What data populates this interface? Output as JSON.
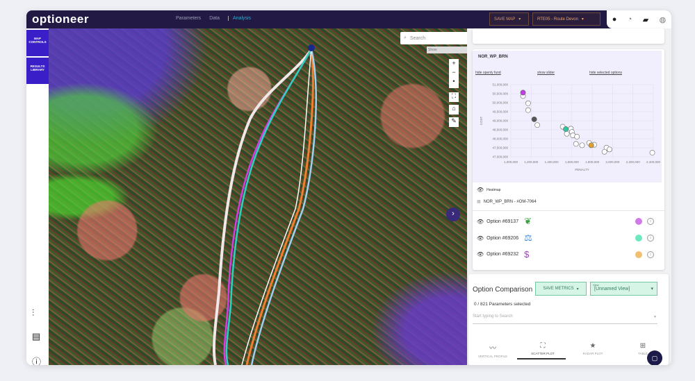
{
  "header": {
    "logo": "optioneer",
    "nav": [
      "Parameters",
      "Data",
      "Analysis"
    ],
    "active_nav": "Analysis",
    "save_map_label": "SAVE MAP",
    "project_label": "Project",
    "project_value": "RTE05 - Route Devon",
    "icons": [
      "help-icon",
      "speedometer-icon",
      "feedback-icon",
      "account-icon"
    ]
  },
  "sidebar": {
    "buttons": [
      "MAP CONTROLS",
      "RESULTS LIBRARY"
    ],
    "icons": [
      "layers-icon",
      "chat-icon",
      "info-icon"
    ]
  },
  "map": {
    "search_placeholder": "Search",
    "search_hint": "Show",
    "controls": [
      "+",
      "−",
      "•"
    ]
  },
  "chart_card": {
    "title": "NOR_WP_BRN",
    "links": [
      "hide openly fund",
      "show slider",
      "hide selected options"
    ]
  },
  "chart_data": {
    "type": "scatter",
    "xlabel": "PENALTY",
    "ylabel": "COST",
    "xlim": [
      1000000,
      2400000
    ],
    "ylim": [
      47000000,
      51000000
    ],
    "xticks": [
      "1,000,000",
      "1,200,000",
      "1,400,000",
      "1,600,000",
      "1,800,000",
      "2,000,000",
      "2,200,000",
      "2,400,000"
    ],
    "yticks": [
      "51,000,000",
      "50,500,000",
      "50,000,000",
      "49,500,000",
      "49,000,000",
      "48,500,000",
      "48,000,000",
      "47,500,000",
      "47,000,000"
    ],
    "grid": true,
    "points": [
      {
        "x": 1120000,
        "y": 50370000,
        "color": "#ffffff"
      },
      {
        "x": 1120000,
        "y": 50560000,
        "color": "#c040e0"
      },
      {
        "x": 1170000,
        "y": 49970000,
        "color": "#ffffff"
      },
      {
        "x": 1170000,
        "y": 49590000,
        "color": "#ffffff"
      },
      {
        "x": 1230000,
        "y": 49080000,
        "color": "#555555"
      },
      {
        "x": 1260000,
        "y": 48760000,
        "color": "#ffffff"
      },
      {
        "x": 1510000,
        "y": 48670000,
        "color": "#ffffff"
      },
      {
        "x": 1550000,
        "y": 48280000,
        "color": "#ffffff"
      },
      {
        "x": 1540000,
        "y": 48540000,
        "color": "#2ec8a0"
      },
      {
        "x": 1590000,
        "y": 48560000,
        "color": "#ffffff"
      },
      {
        "x": 1600000,
        "y": 48380000,
        "color": "#ffffff"
      },
      {
        "x": 1610000,
        "y": 48190000,
        "color": "#ffffff"
      },
      {
        "x": 1650000,
        "y": 48120000,
        "color": "#ffffff"
      },
      {
        "x": 1640000,
        "y": 47720000,
        "color": "#ffffff"
      },
      {
        "x": 1700000,
        "y": 47640000,
        "color": "#ffffff"
      },
      {
        "x": 1770000,
        "y": 47770000,
        "color": "#ffffff"
      },
      {
        "x": 1820000,
        "y": 47670000,
        "color": "#ffffff"
      },
      {
        "x": 1790000,
        "y": 47640000,
        "color": "#e0a030"
      },
      {
        "x": 1940000,
        "y": 47510000,
        "color": "#ffffff"
      },
      {
        "x": 1970000,
        "y": 47410000,
        "color": "#ffffff"
      },
      {
        "x": 1920000,
        "y": 47280000,
        "color": "#ffffff"
      },
      {
        "x": 2390000,
        "y": 47230000,
        "color": "#ffffff"
      }
    ]
  },
  "layers": {
    "heatmap_label": "Heatmap",
    "dataset_label": "NOR_WP_BRN - #OM-7064"
  },
  "options": [
    {
      "label": "Option #69137",
      "icon": "leaf-icon",
      "color": "#d07ae8"
    },
    {
      "label": "Option #69206",
      "icon": "balance-scale-icon",
      "color": "#6ee8c0"
    },
    {
      "label": "Option #69232",
      "icon": "dollar-icon",
      "color": "#f0c070"
    }
  ],
  "comparison": {
    "title": "Option Comparison",
    "save_metrics_label": "SAVE METRICS",
    "view_label": "View",
    "view_value": "[Unnamed View]",
    "params_selected": "0 / 821 Parameters selected",
    "search_placeholder": "Start typing to Search",
    "tabs": [
      {
        "label": "VERTICAL PROFILE",
        "icon": "〰"
      },
      {
        "label": "SCATTER PLOT",
        "icon": "⛶"
      },
      {
        "label": "RADAR PLOT",
        "icon": "★"
      },
      {
        "label": "TABLE",
        "icon": "⊞"
      }
    ],
    "active_tab": "SCATTER PLOT"
  }
}
